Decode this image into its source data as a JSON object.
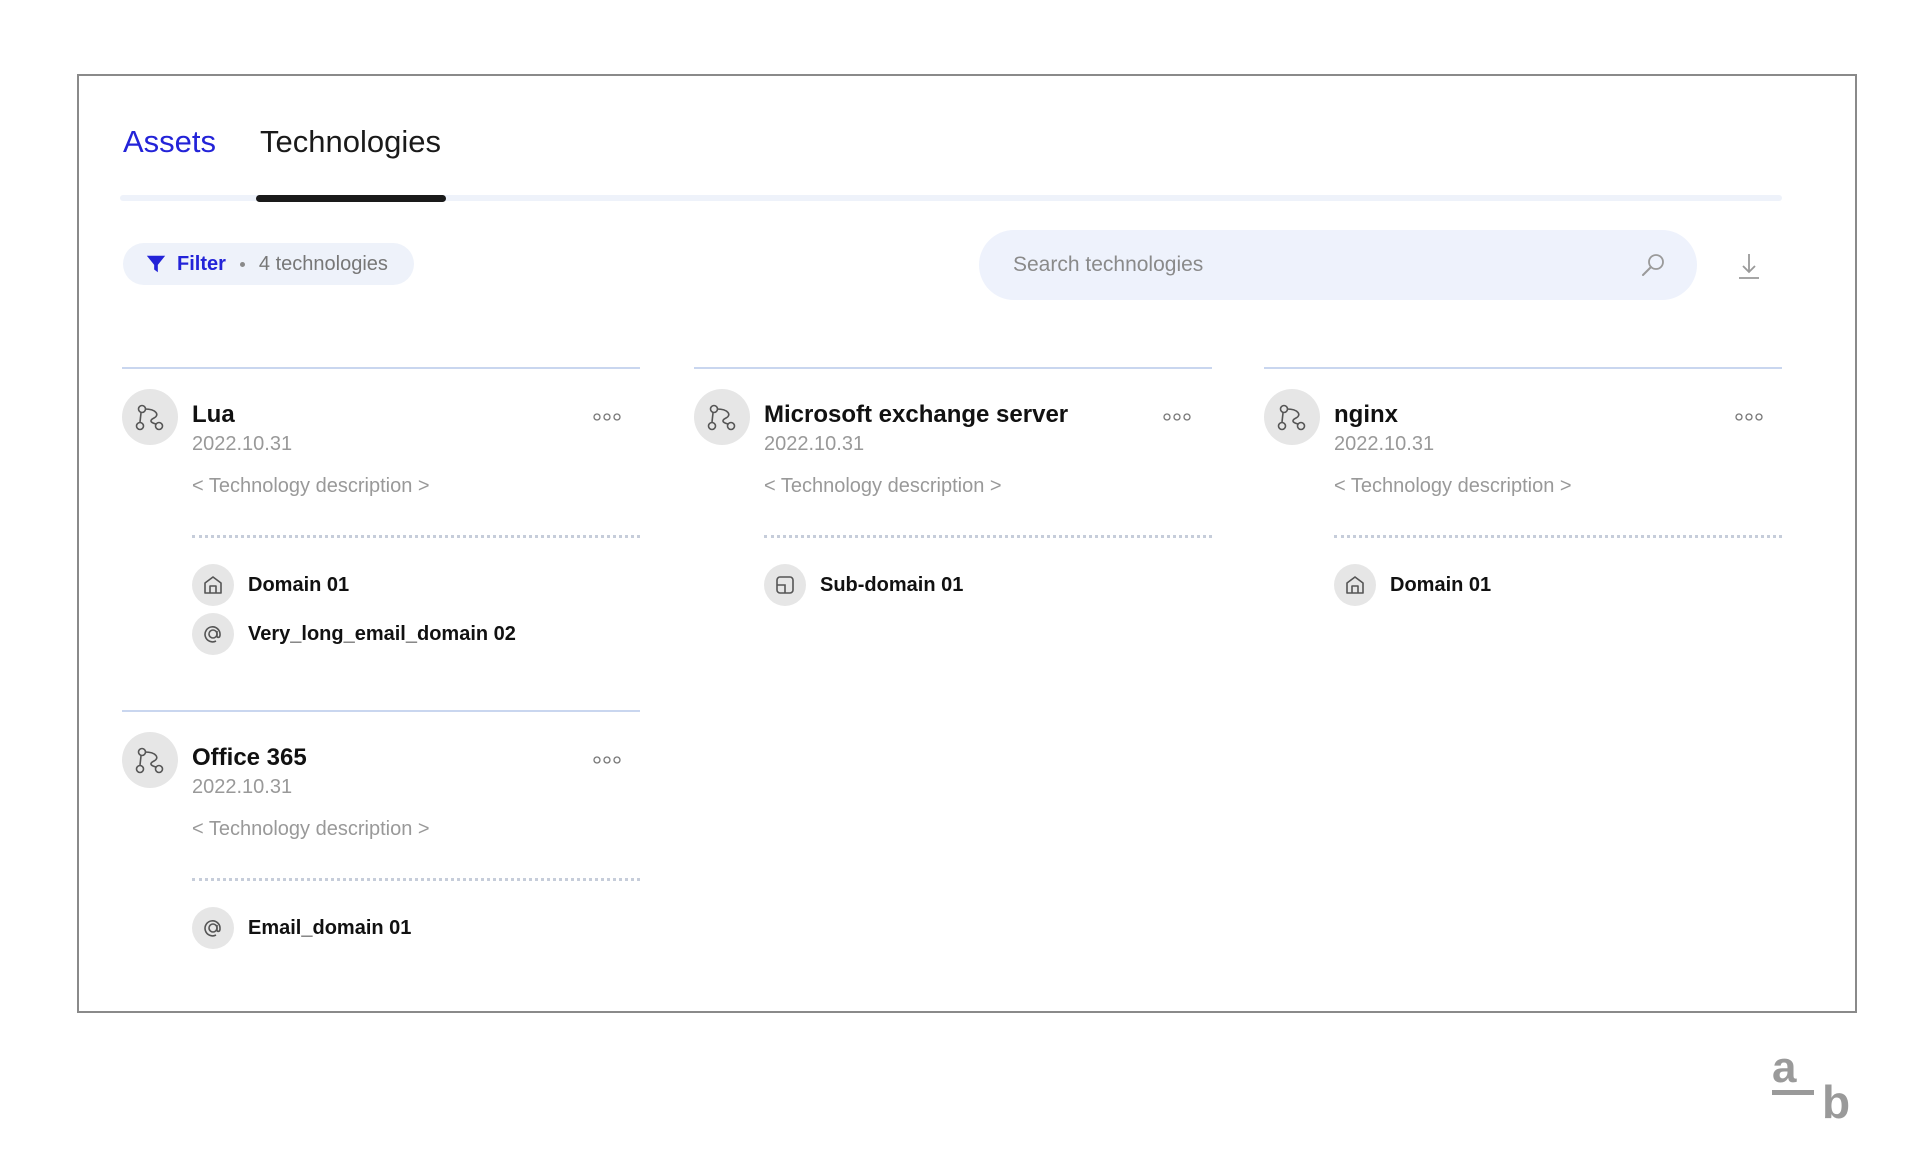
{
  "tabs": [
    {
      "label": "Assets",
      "active": false
    },
    {
      "label": "Technologies",
      "active": true
    }
  ],
  "toolbar": {
    "filter_label": "Filter",
    "filter_count": "4 technologies",
    "search_placeholder": "Search technologies"
  },
  "colors": {
    "accent": "#2323d8",
    "track": "#eef2fa",
    "muted": "#999999"
  },
  "cards": [
    {
      "title": "Lua",
      "date": "2022.10.31",
      "description": "< Technology description >",
      "assets": [
        {
          "icon": "domain-icon",
          "label": "Domain 01"
        },
        {
          "icon": "email-at-icon",
          "label": "Very_long_email_domain 02"
        }
      ]
    },
    {
      "title": "Microsoft exchange server",
      "date": "2022.10.31",
      "description": "< Technology description >",
      "assets": [
        {
          "icon": "subdomain-icon",
          "label": "Sub-domain 01"
        }
      ]
    },
    {
      "title": "nginx",
      "date": "2022.10.31",
      "description": "< Technology description >",
      "assets": [
        {
          "icon": "domain-icon",
          "label": "Domain 01"
        }
      ]
    },
    {
      "title": "Office 365",
      "date": "2022.10.31",
      "description": "< Technology description >",
      "assets": [
        {
          "icon": "email-at-icon",
          "label": "Email_domain 01"
        }
      ]
    }
  ],
  "brand": {
    "top": "a",
    "bottom": "b"
  }
}
